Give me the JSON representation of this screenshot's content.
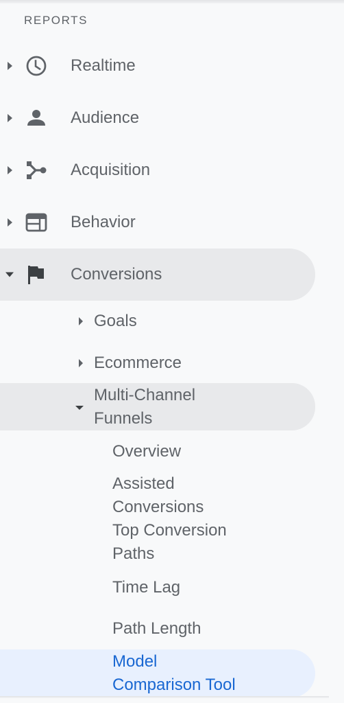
{
  "sidebar": {
    "section_title": "REPORTS",
    "items": [
      {
        "label": "Realtime",
        "icon": "clock-icon",
        "expanded": false
      },
      {
        "label": "Audience",
        "icon": "person-icon",
        "expanded": false
      },
      {
        "label": "Acquisition",
        "icon": "acquisition-icon",
        "expanded": false
      },
      {
        "label": "Behavior",
        "icon": "behavior-icon",
        "expanded": false
      },
      {
        "label": "Conversions",
        "icon": "flag-icon",
        "expanded": true
      }
    ],
    "conversions_children": [
      {
        "label": "Goals",
        "expanded": false
      },
      {
        "label": "Ecommerce",
        "expanded": false
      },
      {
        "label": "Multi-Channel Funnels",
        "label_line1": "Multi-Channel",
        "label_line2": "Funnels",
        "expanded": true
      }
    ],
    "mcf_children": [
      {
        "label": "Overview"
      },
      {
        "label": "Assisted Conversions",
        "label_line1": "Assisted",
        "label_line2": "Conversions"
      },
      {
        "label": "Top Conversion Paths",
        "label_line1": "Top Conversion",
        "label_line2": "Paths"
      },
      {
        "label": "Time Lag"
      },
      {
        "label": "Path Length"
      },
      {
        "label": "Model Comparison Tool",
        "label_line1": "Model",
        "label_line2": "Comparison Tool",
        "selected": true
      }
    ]
  },
  "colors": {
    "background": "#f8f9fa",
    "text": "#5f6368",
    "active_parent_bg": "#e8e9eb",
    "selected_bg": "#e8f0fe",
    "selected_text": "#1967d2"
  }
}
